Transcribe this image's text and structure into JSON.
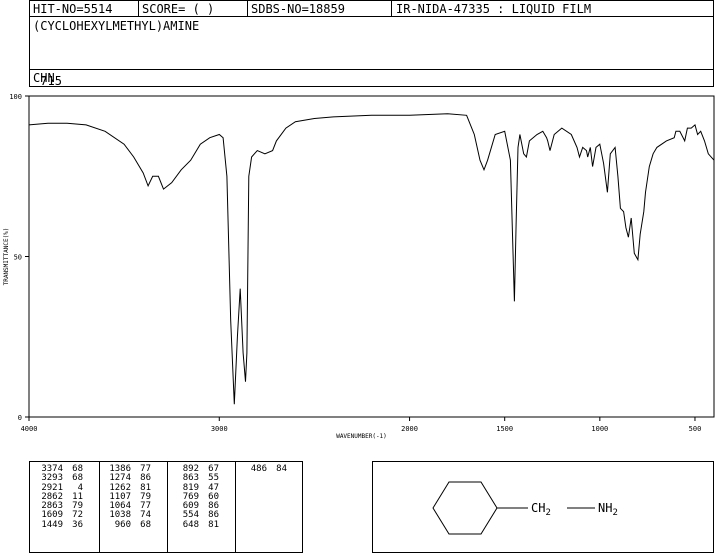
{
  "header": {
    "hit_no": "HIT-NO=5514",
    "score": "SCORE=  (    )",
    "sdbs_no": "SDBS-NO=18859",
    "source": "IR-NIDA-47335 : LIQUID FILM",
    "compound_name": "(CYCLOHEXYLMETHYL)AMINE",
    "formula": {
      "c": "C",
      "c_count": "7",
      "h": "H",
      "h_count": "15",
      "n": "N"
    }
  },
  "chart_data": {
    "type": "line",
    "title": "",
    "xlabel": "WAVENUMBER(-1)",
    "ylabel": "TRANSMITTANCE(%)",
    "xlim": [
      4000,
      400
    ],
    "ylim": [
      0,
      100
    ],
    "x_ticks": [
      4000,
      3000,
      2000,
      1500,
      1000,
      500
    ],
    "y_ticks": [
      0,
      50,
      100
    ],
    "grid": false,
    "series": [
      {
        "color": "#000000",
        "points": [
          [
            4000,
            91
          ],
          [
            3900,
            91.5
          ],
          [
            3800,
            91.5
          ],
          [
            3700,
            91
          ],
          [
            3600,
            89
          ],
          [
            3500,
            85
          ],
          [
            3450,
            81
          ],
          [
            3400,
            76
          ],
          [
            3374,
            72
          ],
          [
            3350,
            75
          ],
          [
            3320,
            75
          ],
          [
            3293,
            71
          ],
          [
            3250,
            73
          ],
          [
            3200,
            77
          ],
          [
            3150,
            80
          ],
          [
            3100,
            85
          ],
          [
            3050,
            87
          ],
          [
            3000,
            88
          ],
          [
            2980,
            87
          ],
          [
            2960,
            75
          ],
          [
            2940,
            30
          ],
          [
            2921,
            4
          ],
          [
            2905,
            25
          ],
          [
            2890,
            40
          ],
          [
            2875,
            20
          ],
          [
            2862,
            11
          ],
          [
            2855,
            20
          ],
          [
            2845,
            75
          ],
          [
            2830,
            81
          ],
          [
            2800,
            83
          ],
          [
            2760,
            82
          ],
          [
            2720,
            83
          ],
          [
            2700,
            86
          ],
          [
            2650,
            90
          ],
          [
            2600,
            92
          ],
          [
            2500,
            93
          ],
          [
            2400,
            93.5
          ],
          [
            2200,
            94
          ],
          [
            2000,
            94
          ],
          [
            1800,
            94.5
          ],
          [
            1700,
            94
          ],
          [
            1660,
            88
          ],
          [
            1630,
            80
          ],
          [
            1609,
            77
          ],
          [
            1590,
            80
          ],
          [
            1550,
            88
          ],
          [
            1500,
            89
          ],
          [
            1470,
            80
          ],
          [
            1449,
            36
          ],
          [
            1440,
            60
          ],
          [
            1430,
            84
          ],
          [
            1420,
            88
          ],
          [
            1400,
            82
          ],
          [
            1386,
            81
          ],
          [
            1370,
            86
          ],
          [
            1330,
            88
          ],
          [
            1300,
            89
          ],
          [
            1280,
            87
          ],
          [
            1274,
            86
          ],
          [
            1262,
            83
          ],
          [
            1240,
            88
          ],
          [
            1200,
            90
          ],
          [
            1150,
            88
          ],
          [
            1120,
            84
          ],
          [
            1107,
            81
          ],
          [
            1090,
            84
          ],
          [
            1070,
            83
          ],
          [
            1064,
            81
          ],
          [
            1050,
            84
          ],
          [
            1038,
            78
          ],
          [
            1020,
            84
          ],
          [
            1000,
            85
          ],
          [
            980,
            79
          ],
          [
            960,
            70
          ],
          [
            945,
            82
          ],
          [
            920,
            84
          ],
          [
            905,
            75
          ],
          [
            892,
            65
          ],
          [
            875,
            64
          ],
          [
            863,
            59
          ],
          [
            850,
            56
          ],
          [
            835,
            62
          ],
          [
            819,
            51
          ],
          [
            800,
            49
          ],
          [
            788,
            57
          ],
          [
            769,
            64
          ],
          [
            760,
            70
          ],
          [
            740,
            78
          ],
          [
            720,
            82
          ],
          [
            700,
            84
          ],
          [
            650,
            86
          ],
          [
            609,
            87
          ],
          [
            600,
            89
          ],
          [
            580,
            89
          ],
          [
            554,
            86
          ],
          [
            540,
            90
          ],
          [
            520,
            90
          ],
          [
            500,
            91
          ],
          [
            486,
            88
          ],
          [
            470,
            89
          ],
          [
            450,
            86
          ],
          [
            430,
            82
          ],
          [
            400,
            80
          ]
        ]
      }
    ]
  },
  "peak_table": {
    "columns": [
      [
        [
          "3374",
          "68"
        ],
        [
          "3293",
          "68"
        ],
        [
          "2921",
          "4"
        ],
        [
          "2862",
          "11"
        ],
        [
          "2863",
          "79"
        ],
        [
          "1609",
          "72"
        ],
        [
          "1449",
          "36"
        ]
      ],
      [
        [
          "1386",
          "77"
        ],
        [
          "1274",
          "86"
        ],
        [
          "1262",
          "81"
        ],
        [
          "1107",
          "79"
        ],
        [
          "1064",
          "77"
        ],
        [
          "1038",
          "74"
        ],
        [
          "960",
          "68"
        ]
      ],
      [
        [
          "892",
          "67"
        ],
        [
          "863",
          "55"
        ],
        [
          "819",
          "47"
        ],
        [
          "769",
          "60"
        ],
        [
          "609",
          "86"
        ],
        [
          "554",
          "86"
        ],
        [
          "648",
          "81"
        ]
      ],
      [
        [
          "486",
          "84"
        ]
      ]
    ]
  },
  "structure": {
    "substituent": "CH",
    "substituent_count": "2",
    "amine": "NH",
    "amine_count": "2"
  }
}
